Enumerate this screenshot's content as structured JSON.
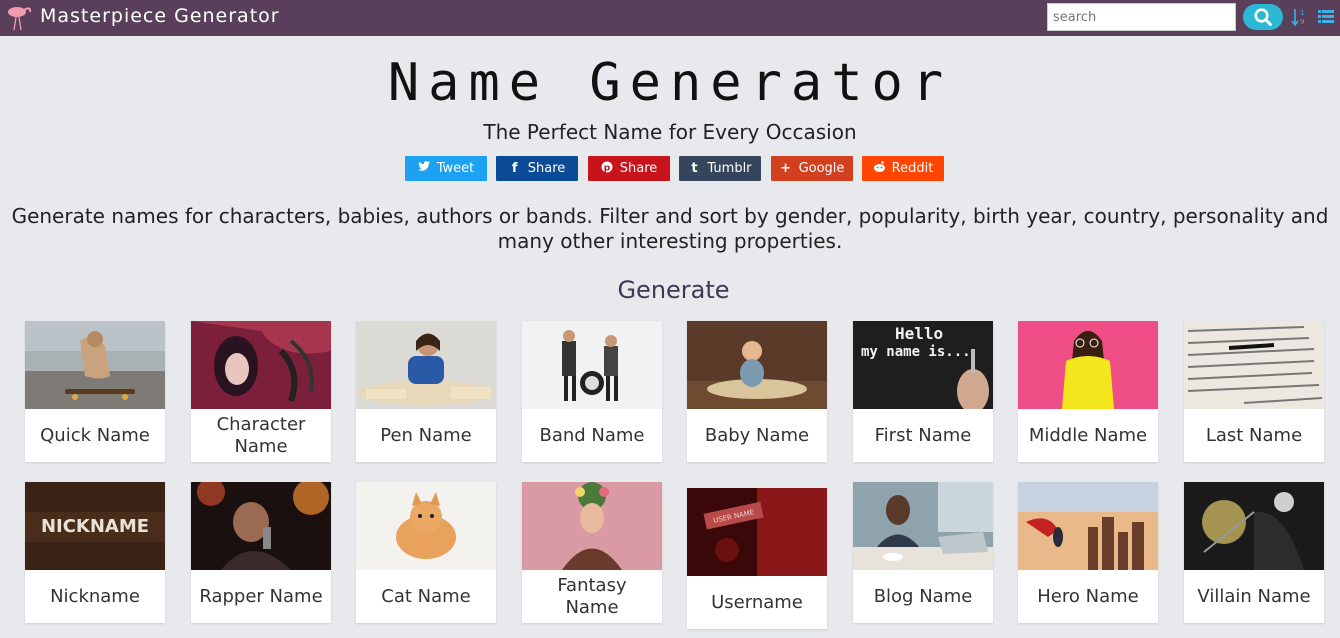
{
  "header": {
    "brand": "Masterpiece Generator",
    "search_placeholder": "search"
  },
  "hero": {
    "title": "Name Generator",
    "subtitle": "The Perfect Name for Every Occasion",
    "intro": "Generate names for characters, babies, authors or bands. Filter and sort by gender, popularity, birth year, country, personality and many other interesting properties."
  },
  "share": [
    {
      "label": "Tweet",
      "icon": "twitter-icon",
      "color": "#1da1f2"
    },
    {
      "label": "Share",
      "icon": "facebook-icon",
      "color": "#0b4a96"
    },
    {
      "label": "Share",
      "icon": "pinterest-icon",
      "color": "#c8121c"
    },
    {
      "label": "Tumblr",
      "icon": "tumblr-icon",
      "color": "#35465c"
    },
    {
      "label": "Google",
      "icon": "google-plus-icon",
      "color": "#d2401f"
    },
    {
      "label": "Reddit",
      "icon": "reddit-icon",
      "color": "#ff4500"
    }
  ],
  "generate": {
    "title": "Generate",
    "cards": [
      {
        "label": "Quick Name"
      },
      {
        "label": "Character Name"
      },
      {
        "label": "Pen Name"
      },
      {
        "label": "Band Name"
      },
      {
        "label": "Baby Name"
      },
      {
        "label": "First Name"
      },
      {
        "label": "Middle Name"
      },
      {
        "label": "Last Name"
      },
      {
        "label": "Nickname",
        "image_text": "NICKNAME"
      },
      {
        "label": "Rapper Name"
      },
      {
        "label": "Cat Name"
      },
      {
        "label": "Fantasy Name"
      },
      {
        "label": "Username",
        "image_text": "USER NAME"
      },
      {
        "label": "Blog Name"
      },
      {
        "label": "Hero Name"
      },
      {
        "label": "Villain Name"
      }
    ]
  },
  "first_name_image": {
    "line1": "Hello",
    "line2": "my name is..."
  }
}
